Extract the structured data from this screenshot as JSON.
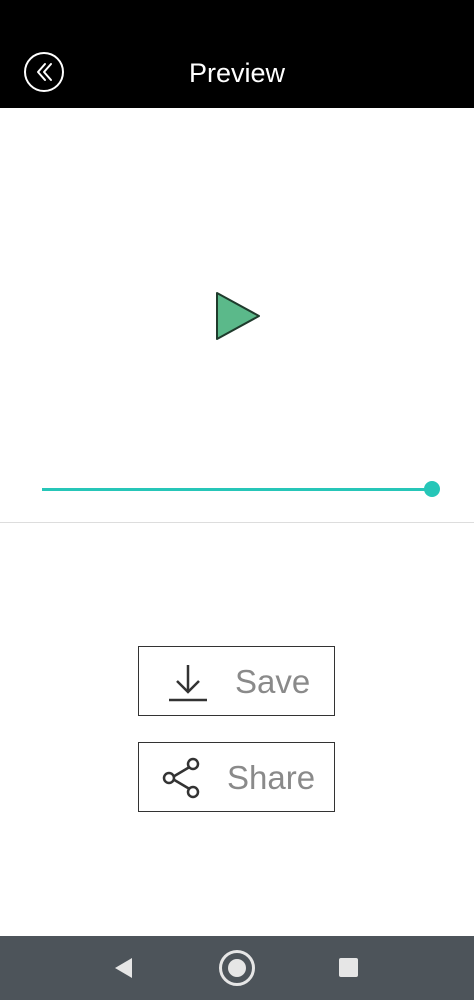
{
  "header": {
    "title": "Preview",
    "back_icon": "chevron-double-left-icon"
  },
  "player": {
    "play_icon": "play-icon",
    "play_color": "#5bb98a",
    "progress_fraction": 1.0,
    "accent_color": "#26c6b8"
  },
  "actions": {
    "save_label": "Save",
    "save_icon": "download-icon",
    "share_label": "Share",
    "share_icon": "share-icon"
  },
  "navbar": {
    "back_icon": "nav-back-triangle-icon",
    "home_icon": "nav-home-circle-icon",
    "recent_icon": "nav-recent-square-icon"
  }
}
